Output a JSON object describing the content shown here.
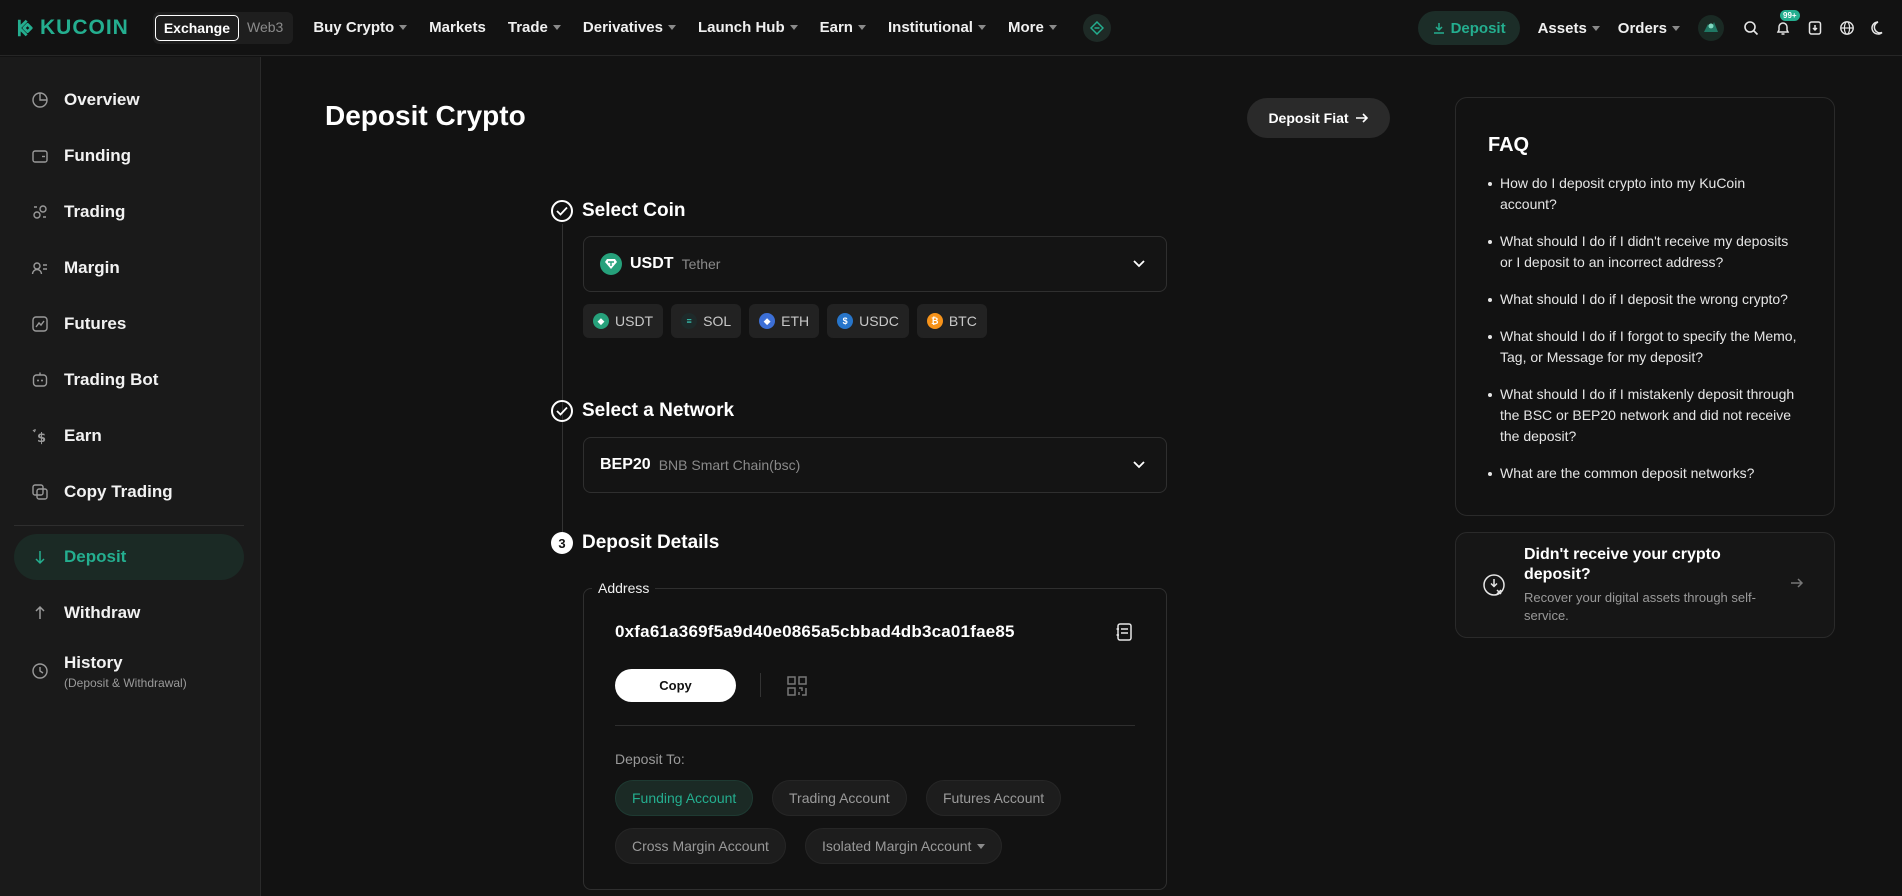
{
  "nav": {
    "logo_text": "KUCOIN",
    "switch": [
      "Exchange",
      "Web3"
    ],
    "items": [
      "Buy Crypto",
      "Markets",
      "Trade",
      "Derivatives",
      "Launch Hub",
      "Earn",
      "Institutional",
      "More"
    ],
    "deposit_label": "Deposit",
    "assets_label": "Assets",
    "orders_label": "Orders",
    "notif_badge": "99+"
  },
  "sidebar": {
    "items": [
      {
        "label": "Overview",
        "icon": "pie-chart-icon"
      },
      {
        "label": "Funding",
        "icon": "wallet-icon"
      },
      {
        "label": "Trading",
        "icon": "trading-icon"
      },
      {
        "label": "Margin",
        "icon": "margin-icon"
      },
      {
        "label": "Futures",
        "icon": "futures-icon"
      },
      {
        "label": "Trading Bot",
        "icon": "bot-icon"
      },
      {
        "label": "Earn",
        "icon": "earn-icon"
      },
      {
        "label": "Copy Trading",
        "icon": "copy-trading-icon"
      },
      {
        "label": "Deposit",
        "icon": "arrow-down-icon"
      },
      {
        "label": "Withdraw",
        "icon": "arrow-up-icon"
      },
      {
        "label": "History",
        "icon": "clock-icon"
      }
    ],
    "history_sub": "(Deposit & Withdrawal)"
  },
  "main": {
    "title": "Deposit Crypto",
    "fiat_button": "Deposit Fiat",
    "step1_title": "Select Coin",
    "coin_symbol": "USDT",
    "coin_name": "Tether",
    "quick_coins": [
      "USDT",
      "SOL",
      "ETH",
      "USDC",
      "BTC"
    ],
    "step2_title": "Select a Network",
    "network_symbol": "BEP20",
    "network_name": "BNB Smart Chain(bsc)",
    "step3_num": "3",
    "step3_title": "Deposit Details",
    "address_label": "Address",
    "address": "0xfa61a369f5a9d40e0865a5cbbad4db3ca01fae85",
    "copy_label": "Copy",
    "deposit_to_label": "Deposit To:",
    "accounts": [
      "Funding Account",
      "Trading Account",
      "Futures Account",
      "Cross Margin Account",
      "Isolated Margin Account"
    ]
  },
  "faq": {
    "title": "FAQ",
    "items": [
      "How do I deposit crypto into my KuCoin account?",
      "What should I do if I didn't receive my deposits or I deposit to an incorrect address?",
      "What should I do if I deposit the wrong crypto?",
      "What should I do if I forgot to specify the Memo, Tag, or Message for my deposit?",
      "What should I do if I mistakenly deposit through the BSC or BEP20 network and did not receive the deposit?",
      "What are the common deposit networks?"
    ]
  },
  "recover": {
    "title": "Didn't receive your crypto deposit?",
    "subtitle": "Recover your digital assets through self-service."
  },
  "colors": {
    "accent": "#24ae8f",
    "background": "#121212",
    "sidebar": "#1a1a1a"
  }
}
